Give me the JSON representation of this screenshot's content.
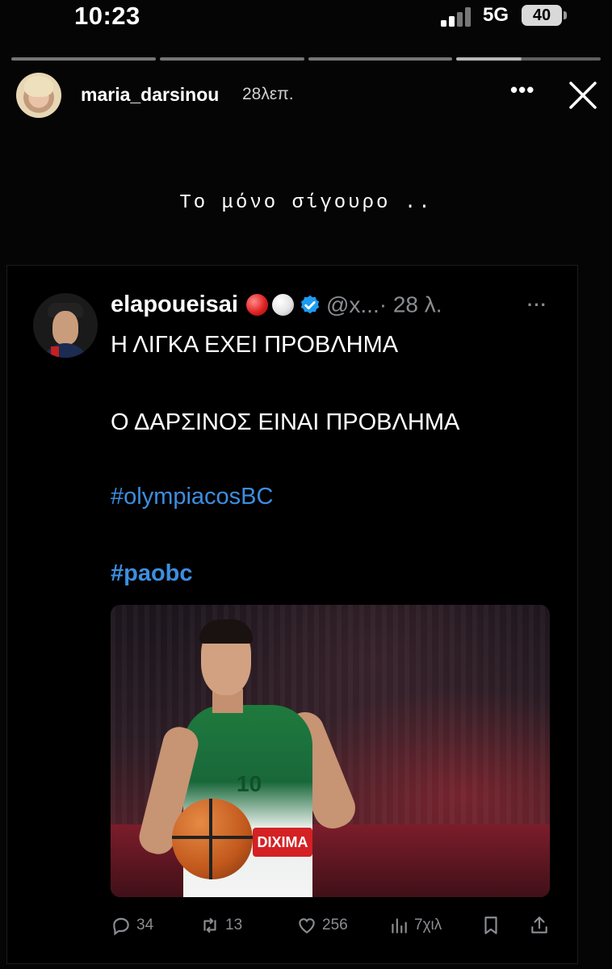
{
  "status_bar": {
    "time": "10:23",
    "network": "5G",
    "battery": "40"
  },
  "story": {
    "username": "maria_darsinou",
    "time_ago": "28λεπ.",
    "more_label": "•••",
    "caption": "Το μόνο σίγουρο .."
  },
  "tweet": {
    "display_name": "elapoueisai",
    "handle": "@x...",
    "time": "· 28 λ.",
    "more_label": "···",
    "lines": [
      "Η ΛΙΓΚΑ ΕΧΕΙ ΠΡΟΒΛΗΜΑ",
      "Ο ΔΑΡΣΙΝΟΣ ΕΙΝΑΙ ΠΡΟΒΛΗΜΑ"
    ],
    "hashtags": [
      "#olympiacosBC",
      "#paobc"
    ],
    "media": {
      "jersey_number": "10",
      "sponsor": "DIXIMA"
    },
    "stats": {
      "replies": "34",
      "retweets": "13",
      "likes": "256",
      "views": "7χιλ"
    }
  },
  "colors": {
    "background": "#050505",
    "hashtag": "#3d8ee0",
    "muted": "#8a8d91",
    "verified": "#1d9bf0"
  }
}
